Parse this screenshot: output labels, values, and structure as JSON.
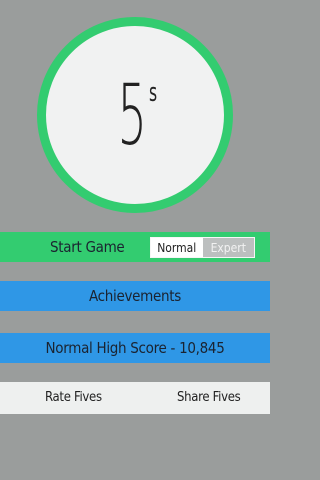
{
  "logo": {
    "number": "5",
    "superscript": "s"
  },
  "start": {
    "label": "Start Game"
  },
  "mode": {
    "normal": "Normal",
    "expert": "Expert",
    "selected": "Normal"
  },
  "achievements": {
    "label": "Achievements"
  },
  "score": {
    "label": "Normal High Score - 10,845"
  },
  "footer": {
    "rate": "Rate Fives",
    "share": "Share Fives"
  },
  "colors": {
    "accent_green": "#33cc70",
    "accent_blue": "#2f97e6",
    "background": "#9a9d9c"
  }
}
